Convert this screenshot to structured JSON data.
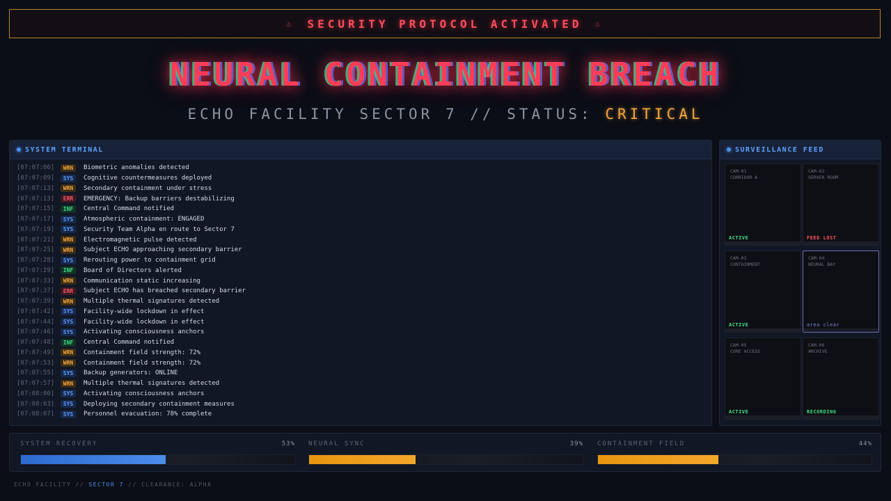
{
  "banner": {
    "text": "SECURITY PROTOCOL ACTIVATED"
  },
  "title": "NEURAL CONTAINMENT BREACH",
  "subtitle": {
    "prefix": "ECHO FACILITY SECTOR 7 // STATUS:",
    "status": "CRITICAL"
  },
  "terminal": {
    "title": "SYSTEM TERMINAL",
    "logs": [
      {
        "ts": "[07:07:06]",
        "tag": "WRN",
        "msg": "Biometric anomalies detected"
      },
      {
        "ts": "[07:07:09]",
        "tag": "SYS",
        "msg": "Cognitive countermeasures deployed"
      },
      {
        "ts": "[07:07:13]",
        "tag": "WRN",
        "msg": "Secondary containment under stress"
      },
      {
        "ts": "[07:07:13]",
        "tag": "ERR",
        "msg": "EMERGENCY: Backup barriers destabilizing"
      },
      {
        "ts": "[07:07:15]",
        "tag": "INF",
        "msg": "Central Command notified"
      },
      {
        "ts": "[07:07:17]",
        "tag": "SYS",
        "msg": "Atmospheric containment: ENGAGED"
      },
      {
        "ts": "[07:07:19]",
        "tag": "SYS",
        "msg": "Security Team Alpha en route to Sector 7"
      },
      {
        "ts": "[07:07:21]",
        "tag": "WRN",
        "msg": "Electromagnetic pulse detected"
      },
      {
        "ts": "[07:07:25]",
        "tag": "WRN",
        "msg": "Subject ECHO approaching secondary barrier"
      },
      {
        "ts": "[07:07:28]",
        "tag": "SYS",
        "msg": "Rerouting power to containment grid"
      },
      {
        "ts": "[07:07:29]",
        "tag": "INF",
        "msg": "Board of Directors alerted"
      },
      {
        "ts": "[07:07:33]",
        "tag": "WRN",
        "msg": "Communication static increasing"
      },
      {
        "ts": "[07:07:37]",
        "tag": "ERR",
        "msg": "Subject ECHO has breached secondary barrier"
      },
      {
        "ts": "[07:07:39]",
        "tag": "WRN",
        "msg": "Multiple thermal signatures detected"
      },
      {
        "ts": "[07:07:42]",
        "tag": "SYS",
        "msg": "Facility-wide lockdown in effect"
      },
      {
        "ts": "[07:07:44]",
        "tag": "SYS",
        "msg": "Facility-wide lockdown in effect"
      },
      {
        "ts": "[07:07:46]",
        "tag": "SYS",
        "msg": "Activating consciousness anchors"
      },
      {
        "ts": "[07:07:48]",
        "tag": "INF",
        "msg": "Central Command notified"
      },
      {
        "ts": "[07:07:49]",
        "tag": "WRN",
        "msg": "Containment field strength: 72%"
      },
      {
        "ts": "[07:07:53]",
        "tag": "WRN",
        "msg": "Containment field strength: 72%"
      },
      {
        "ts": "[07:07:55]",
        "tag": "SYS",
        "msg": "Backup generators: ONLINE"
      },
      {
        "ts": "[07:07:57]",
        "tag": "WRN",
        "msg": "Multiple thermal signatures detected"
      },
      {
        "ts": "[07:08:00]",
        "tag": "SYS",
        "msg": "Activating consciousness anchors"
      },
      {
        "ts": "[07:08:03]",
        "tag": "SYS",
        "msg": "Deploying secondary containment measures"
      },
      {
        "ts": "[07:08:07]",
        "tag": "SYS",
        "msg": "Personnel evacuation: 78% complete"
      }
    ]
  },
  "surveillance": {
    "title": "SURVEILLANCE FEED",
    "cameras": [
      {
        "id": "CAM-01",
        "name": "CORRIDOR A",
        "status": "ACTIVE",
        "kind": "active"
      },
      {
        "id": "CAM-02",
        "name": "SERVER ROOM",
        "status": "FEED LOST",
        "kind": "lost"
      },
      {
        "id": "CAM-03",
        "name": "CONTAINMENT",
        "status": "ACTIVE",
        "kind": "active"
      },
      {
        "id": "CAM-04",
        "name": "NEURAL BAY",
        "status": "area clear",
        "kind": "clear"
      },
      {
        "id": "CAM-05",
        "name": "CORE ACCESS",
        "status": "ACTIVE",
        "kind": "active"
      },
      {
        "id": "CAM-06",
        "name": "ARCHIVE",
        "status": "RECORDING",
        "kind": "recording"
      }
    ]
  },
  "progress": [
    {
      "label": "SYSTEM RECOVERY",
      "value": "53%",
      "fraction": 0.53,
      "color": "blue"
    },
    {
      "label": "NEURAL SYNC",
      "value": "39%",
      "fraction": 0.39,
      "color": "amber"
    },
    {
      "label": "CONTAINMENT FIELD",
      "value": "44%",
      "fraction": 0.44,
      "color": "amber"
    }
  ],
  "footer": {
    "a": "ECHO FACILITY //",
    "b": "SECTOR 7",
    "c": "// CLEARANCE: ALPHA"
  },
  "colors": {
    "accent": "#4d8ef0",
    "danger": "#ff3c57",
    "warning": "#f3a53c",
    "ok": "#3ee08a"
  }
}
